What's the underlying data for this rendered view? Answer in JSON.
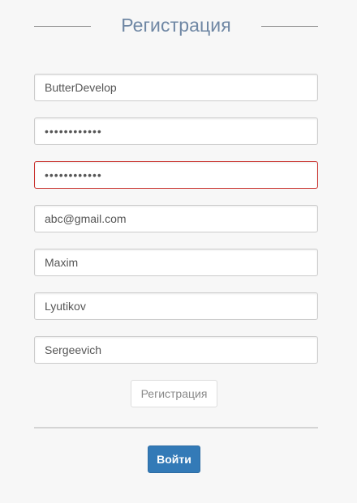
{
  "header": {
    "title": "Регистрация"
  },
  "form": {
    "username": {
      "value": "ButterDevelop"
    },
    "password": {
      "value": "••••••••••••"
    },
    "password_confirm": {
      "value": "••••••••••••",
      "state": "error"
    },
    "email": {
      "value": "abc@gmail.com"
    },
    "first_name": {
      "value": "Maxim"
    },
    "last_name": {
      "value": "Lyutikov"
    },
    "middle_name": {
      "value": "Sergeevich"
    }
  },
  "buttons": {
    "register_label": "Регистрация",
    "login_label": "Войти"
  },
  "colors": {
    "title": "#6f87a4",
    "error_border": "#c9302c",
    "primary": "#337ab7",
    "background": "#f7f7f7"
  }
}
